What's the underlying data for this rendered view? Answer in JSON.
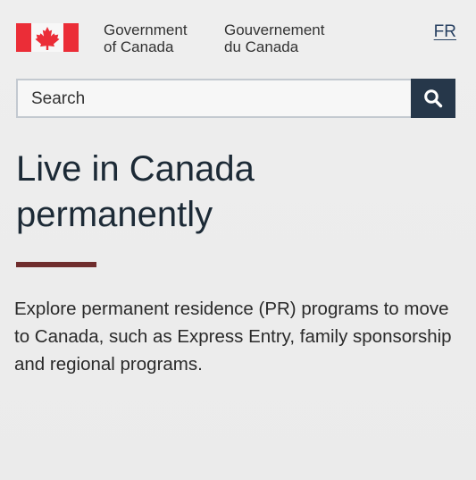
{
  "header": {
    "signature_en_line1": "Government",
    "signature_en_line2": "of Canada",
    "signature_fr_line1": "Gouvernement",
    "signature_fr_line2": "du Canada",
    "language_toggle": "FR"
  },
  "search": {
    "placeholder": "Search"
  },
  "main": {
    "title_line1": "Live in Canada",
    "title_line2": "permanently",
    "intro": "Explore permanent residence (PR) programs to move to Canada, such as Express Entry, family sponsorship and regional programs."
  },
  "colors": {
    "flag_red": "#eb2d37",
    "search_button": "#26374a",
    "accent_bar": "#6f2d2d"
  }
}
